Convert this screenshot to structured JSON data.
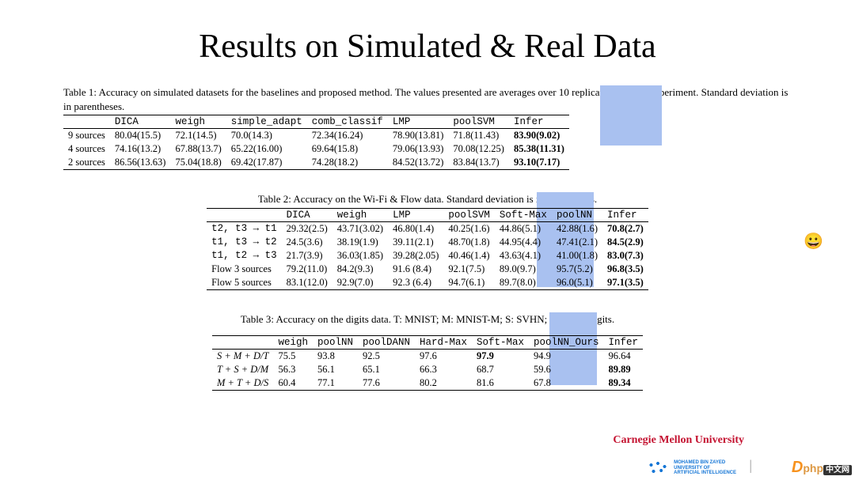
{
  "title": "Results on Simulated & Real Data",
  "table1": {
    "caption": "Table 1: Accuracy on simulated datasets for the baselines and proposed method. The values presented are averages over 10 replicates for each experiment. Standard deviation is in parentheses.",
    "headers": [
      "",
      "DICA",
      "weigh",
      "simple_adapt",
      "comb_classif",
      "LMP",
      "poolSVM",
      "Infer"
    ],
    "rows": [
      {
        "label": "9 sources",
        "cells": [
          "80.04(15.5)",
          "72.1(14.5)",
          "70.0(14.3)",
          "72.34(16.24)",
          "78.90(13.81)",
          "71.8(11.43)",
          "83.90(9.02)"
        ],
        "bold_last": true
      },
      {
        "label": "4 sources",
        "cells": [
          "74.16(13.2)",
          "67.88(13.7)",
          "65.22(16.00)",
          "69.64(15.8)",
          "79.06(13.93)",
          "70.08(12.25)",
          "85.38(11.31)"
        ],
        "bold_last": true
      },
      {
        "label": "2 sources",
        "cells": [
          "86.56(13.63)",
          "75.04(18.8)",
          "69.42(17.87)",
          "74.28(18.2)",
          "84.52(13.72)",
          "83.84(13.7)",
          "93.10(7.17)"
        ],
        "bold_last": true
      }
    ]
  },
  "table2": {
    "caption": "Table 2: Accuracy on the Wi-Fi & Flow data. Standard deviation is in parentheses.",
    "headers": [
      "",
      "DICA",
      "weigh",
      "LMP",
      "poolSVM",
      "Soft-Max",
      "poolNN",
      "Infer"
    ],
    "rows": [
      {
        "label": "t2, t3 → t1",
        "label_mono": true,
        "cells": [
          "29.32(2.5)",
          "43.71(3.02)",
          "46.80(1.4)",
          "40.25(1.6)",
          "44.86(5.1)",
          "42.88(1.6)",
          "70.8(2.7)"
        ],
        "bold_last": true
      },
      {
        "label": "t1, t3 → t2",
        "label_mono": true,
        "cells": [
          "24.5(3.6)",
          "38.19(1.9)",
          "39.11(2.1)",
          "48.70(1.8)",
          "44.95(4.4)",
          "47.41(2.1)",
          "84.5(2.9)"
        ],
        "bold_last": true
      },
      {
        "label": "t1, t2 → t3",
        "label_mono": true,
        "cells": [
          "21.7(3.9)",
          "36.03(1.85)",
          "39.28(2.05)",
          "40.46(1.4)",
          "43.63(4.1)",
          "41.00(1.8)",
          "83.0(7.3)"
        ],
        "bold_last": true
      },
      {
        "label": "Flow 3 sources",
        "label_mono": false,
        "cells": [
          "79.2(11.0)",
          "84.2(9.3)",
          "91.6 (8.4)",
          "92.1(7.5)",
          "89.0(9.7)",
          "95.7(5.2)",
          "96.8(3.5)"
        ],
        "bold_last": true
      },
      {
        "label": "Flow 5 sources",
        "label_mono": false,
        "cells": [
          "83.1(12.0)",
          "92.9(7.0)",
          "92.3 (6.4)",
          "94.7(6.1)",
          "89.7(8.0)",
          "96.0(5.1)",
          "97.1(3.5)"
        ],
        "bold_last": true
      }
    ]
  },
  "table3": {
    "caption": "Table 3: Accuracy on the digits data. T: MNIST; M: MNIST-M; S: SVHN; D: SynthDigits.",
    "headers": [
      "",
      "weigh",
      "poolNN",
      "poolDANN",
      "Hard-Max",
      "Soft-Max",
      "poolNN_Ours",
      "Infer"
    ],
    "rows": [
      {
        "label": "S + M + D/T",
        "cells": [
          "75.5",
          "93.8",
          "92.5",
          "97.6",
          "97.9",
          "94.9",
          "96.64"
        ],
        "bold_idx": 4
      },
      {
        "label": "T + S + D/M",
        "cells": [
          "56.3",
          "56.1",
          "65.1",
          "66.3",
          "68.7",
          "59.6",
          "89.89"
        ],
        "bold_idx": 6
      },
      {
        "label": "M + T + D/S",
        "cells": [
          "60.4",
          "77.1",
          "77.6",
          "80.2",
          "81.6",
          "67.8",
          "89.34"
        ],
        "bold_idx": 6
      }
    ]
  },
  "emoji": "😀",
  "footer": {
    "cmu": "Carnegie Mellon University",
    "mbzuai_line1": "MOHAMED BIN ZAYED",
    "mbzuai_line2": "UNIVERSITY OF",
    "mbzuai_line3": "ARTIFICIAL INTELLIGENCE",
    "sep": "|",
    "phpcn_d": "D",
    "phpcn_php": "php",
    "phpcn_cn": "中文网"
  }
}
